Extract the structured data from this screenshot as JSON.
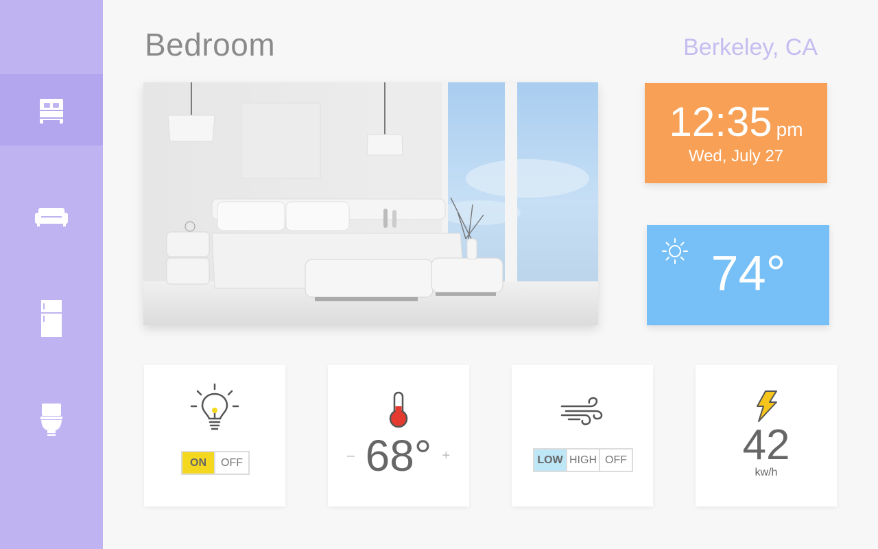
{
  "header": {
    "title": "Bedroom",
    "location": "Berkeley, CA"
  },
  "sidebar": {
    "items": [
      {
        "name": "bed-icon",
        "active": true
      },
      {
        "name": "sofa-icon",
        "active": false
      },
      {
        "name": "refrigerator-icon",
        "active": false
      },
      {
        "name": "toilet-icon",
        "active": false
      }
    ],
    "color": "#c0b3f2"
  },
  "clock": {
    "time": "12:35",
    "ampm": "pm",
    "date": "Wed, July 27",
    "color": "#f8a055"
  },
  "weather": {
    "temperature": "74°",
    "icon": "sun-icon",
    "color": "#76c0f7"
  },
  "controls": {
    "lights": {
      "icon": "lightbulb-icon",
      "on_label": "ON",
      "off_label": "OFF",
      "selected": "ON"
    },
    "thermostat": {
      "icon": "thermometer-icon",
      "decrement": "–",
      "value": "68°",
      "increment": "+"
    },
    "fan": {
      "icon": "wind-icon",
      "low_label": "LOW",
      "high_label": "HIGH",
      "off_label": "OFF",
      "selected": "LOW"
    },
    "energy": {
      "icon": "lightning-icon",
      "value": "42",
      "unit": "kw/h"
    }
  }
}
